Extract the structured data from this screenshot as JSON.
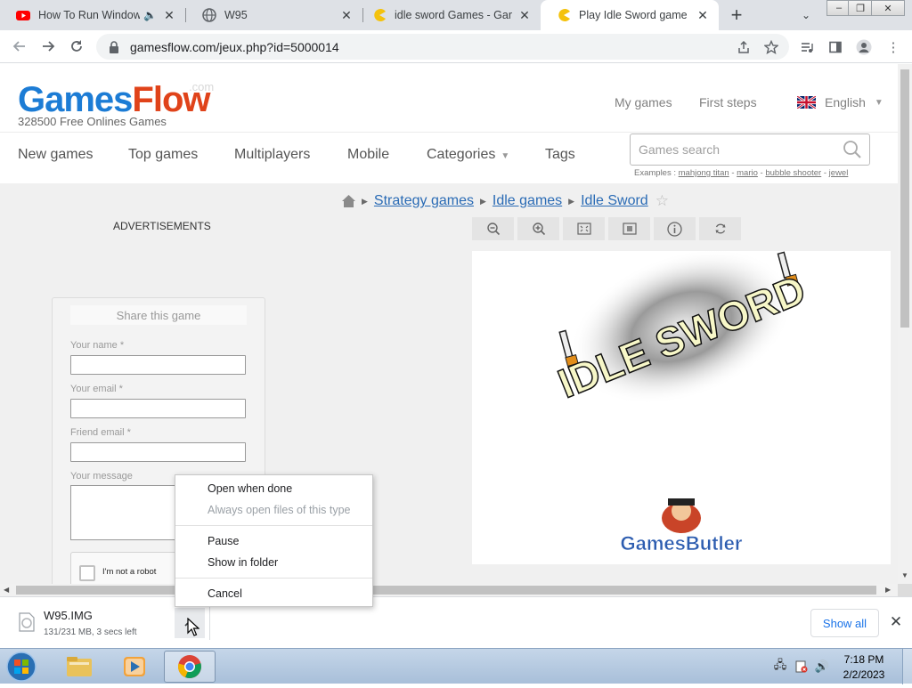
{
  "browser": {
    "tabs": [
      {
        "title": "How To Run Window",
        "favicon": "youtube-icon",
        "audio": true
      },
      {
        "title": "W95",
        "favicon": "globe-icon"
      },
      {
        "title": "idle sword Games - Game",
        "favicon": "pacman-icon"
      },
      {
        "title": "Play Idle Sword game - G",
        "favicon": "pacman-icon",
        "active": true
      }
    ],
    "url": "gamesflow.com/jeux.php?id=5000014"
  },
  "site": {
    "logo_games": "Games",
    "logo_flow": "Flow",
    "logo_com": ".com",
    "tagline": "328500 Free Onlines Games",
    "header_links": [
      "My games",
      "First steps"
    ],
    "language": "English",
    "menu": [
      "New games",
      "Top games",
      "Multiplayers",
      "Mobile",
      "Categories",
      "Tags"
    ],
    "search_placeholder": "Games search",
    "examples_label": "Examples :",
    "examples": [
      "mahjong titan",
      "mario",
      "bubble shooter",
      "jewel"
    ]
  },
  "breadcrumb": [
    "Strategy games",
    "Idle games",
    "Idle Sword"
  ],
  "ads_label": "ADVERTISEMENTS",
  "share": {
    "title": "Share this game",
    "name_label": "Your name *",
    "email_label": "Your email *",
    "friend_label": "Friend email *",
    "message_label": "Your message",
    "captcha_label": "I'm not a robot"
  },
  "game": {
    "title_text": "IDLE SWORD",
    "publisher": "GamesButler"
  },
  "download": {
    "filename": "W95.IMG",
    "status": "131/231 MB, 3 secs left",
    "show_all": "Show all"
  },
  "context_menu": {
    "items": [
      {
        "label": "Open when done",
        "enabled": true
      },
      {
        "label": "Always open files of this type",
        "enabled": false
      },
      {
        "label": "Pause",
        "enabled": true
      },
      {
        "label": "Show in folder",
        "enabled": true
      },
      {
        "label": "Cancel",
        "enabled": true
      }
    ]
  },
  "taskbar": {
    "time": "7:18 PM",
    "date": "2/2/2023"
  },
  "colors": {
    "brand_blue": "#1c7cd5",
    "brand_red": "#e0431a",
    "link_blue": "#2a6bb5",
    "chrome_blue": "#1a73e8"
  }
}
